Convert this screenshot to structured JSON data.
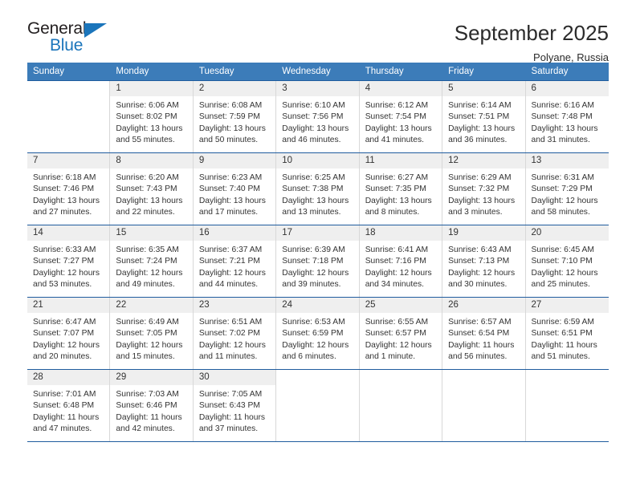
{
  "brand": {
    "name_top": "General",
    "name_bottom": "Blue",
    "triangle_icon": "triangle-icon",
    "accent_color": "#1b75bb"
  },
  "header": {
    "title": "September 2025",
    "subtitle": "Polyane, Russia"
  },
  "theme": {
    "header_bg": "#3c7cb9",
    "row_divider": "#1f5c9e",
    "daynum_bg": "#efefef",
    "text": "#333333"
  },
  "weekday_headers": [
    "Sunday",
    "Monday",
    "Tuesday",
    "Wednesday",
    "Thursday",
    "Friday",
    "Saturday"
  ],
  "weeks": [
    [
      {
        "day": "",
        "sunrise": "",
        "sunset": "",
        "daylight_1": "",
        "daylight_2": ""
      },
      {
        "day": "1",
        "sunrise": "Sunrise: 6:06 AM",
        "sunset": "Sunset: 8:02 PM",
        "daylight_1": "Daylight: 13 hours",
        "daylight_2": "and 55 minutes."
      },
      {
        "day": "2",
        "sunrise": "Sunrise: 6:08 AM",
        "sunset": "Sunset: 7:59 PM",
        "daylight_1": "Daylight: 13 hours",
        "daylight_2": "and 50 minutes."
      },
      {
        "day": "3",
        "sunrise": "Sunrise: 6:10 AM",
        "sunset": "Sunset: 7:56 PM",
        "daylight_1": "Daylight: 13 hours",
        "daylight_2": "and 46 minutes."
      },
      {
        "day": "4",
        "sunrise": "Sunrise: 6:12 AM",
        "sunset": "Sunset: 7:54 PM",
        "daylight_1": "Daylight: 13 hours",
        "daylight_2": "and 41 minutes."
      },
      {
        "day": "5",
        "sunrise": "Sunrise: 6:14 AM",
        "sunset": "Sunset: 7:51 PM",
        "daylight_1": "Daylight: 13 hours",
        "daylight_2": "and 36 minutes."
      },
      {
        "day": "6",
        "sunrise": "Sunrise: 6:16 AM",
        "sunset": "Sunset: 7:48 PM",
        "daylight_1": "Daylight: 13 hours",
        "daylight_2": "and 31 minutes."
      }
    ],
    [
      {
        "day": "7",
        "sunrise": "Sunrise: 6:18 AM",
        "sunset": "Sunset: 7:46 PM",
        "daylight_1": "Daylight: 13 hours",
        "daylight_2": "and 27 minutes."
      },
      {
        "day": "8",
        "sunrise": "Sunrise: 6:20 AM",
        "sunset": "Sunset: 7:43 PM",
        "daylight_1": "Daylight: 13 hours",
        "daylight_2": "and 22 minutes."
      },
      {
        "day": "9",
        "sunrise": "Sunrise: 6:23 AM",
        "sunset": "Sunset: 7:40 PM",
        "daylight_1": "Daylight: 13 hours",
        "daylight_2": "and 17 minutes."
      },
      {
        "day": "10",
        "sunrise": "Sunrise: 6:25 AM",
        "sunset": "Sunset: 7:38 PM",
        "daylight_1": "Daylight: 13 hours",
        "daylight_2": "and 13 minutes."
      },
      {
        "day": "11",
        "sunrise": "Sunrise: 6:27 AM",
        "sunset": "Sunset: 7:35 PM",
        "daylight_1": "Daylight: 13 hours",
        "daylight_2": "and 8 minutes."
      },
      {
        "day": "12",
        "sunrise": "Sunrise: 6:29 AM",
        "sunset": "Sunset: 7:32 PM",
        "daylight_1": "Daylight: 13 hours",
        "daylight_2": "and 3 minutes."
      },
      {
        "day": "13",
        "sunrise": "Sunrise: 6:31 AM",
        "sunset": "Sunset: 7:29 PM",
        "daylight_1": "Daylight: 12 hours",
        "daylight_2": "and 58 minutes."
      }
    ],
    [
      {
        "day": "14",
        "sunrise": "Sunrise: 6:33 AM",
        "sunset": "Sunset: 7:27 PM",
        "daylight_1": "Daylight: 12 hours",
        "daylight_2": "and 53 minutes."
      },
      {
        "day": "15",
        "sunrise": "Sunrise: 6:35 AM",
        "sunset": "Sunset: 7:24 PM",
        "daylight_1": "Daylight: 12 hours",
        "daylight_2": "and 49 minutes."
      },
      {
        "day": "16",
        "sunrise": "Sunrise: 6:37 AM",
        "sunset": "Sunset: 7:21 PM",
        "daylight_1": "Daylight: 12 hours",
        "daylight_2": "and 44 minutes."
      },
      {
        "day": "17",
        "sunrise": "Sunrise: 6:39 AM",
        "sunset": "Sunset: 7:18 PM",
        "daylight_1": "Daylight: 12 hours",
        "daylight_2": "and 39 minutes."
      },
      {
        "day": "18",
        "sunrise": "Sunrise: 6:41 AM",
        "sunset": "Sunset: 7:16 PM",
        "daylight_1": "Daylight: 12 hours",
        "daylight_2": "and 34 minutes."
      },
      {
        "day": "19",
        "sunrise": "Sunrise: 6:43 AM",
        "sunset": "Sunset: 7:13 PM",
        "daylight_1": "Daylight: 12 hours",
        "daylight_2": "and 30 minutes."
      },
      {
        "day": "20",
        "sunrise": "Sunrise: 6:45 AM",
        "sunset": "Sunset: 7:10 PM",
        "daylight_1": "Daylight: 12 hours",
        "daylight_2": "and 25 minutes."
      }
    ],
    [
      {
        "day": "21",
        "sunrise": "Sunrise: 6:47 AM",
        "sunset": "Sunset: 7:07 PM",
        "daylight_1": "Daylight: 12 hours",
        "daylight_2": "and 20 minutes."
      },
      {
        "day": "22",
        "sunrise": "Sunrise: 6:49 AM",
        "sunset": "Sunset: 7:05 PM",
        "daylight_1": "Daylight: 12 hours",
        "daylight_2": "and 15 minutes."
      },
      {
        "day": "23",
        "sunrise": "Sunrise: 6:51 AM",
        "sunset": "Sunset: 7:02 PM",
        "daylight_1": "Daylight: 12 hours",
        "daylight_2": "and 11 minutes."
      },
      {
        "day": "24",
        "sunrise": "Sunrise: 6:53 AM",
        "sunset": "Sunset: 6:59 PM",
        "daylight_1": "Daylight: 12 hours",
        "daylight_2": "and 6 minutes."
      },
      {
        "day": "25",
        "sunrise": "Sunrise: 6:55 AM",
        "sunset": "Sunset: 6:57 PM",
        "daylight_1": "Daylight: 12 hours",
        "daylight_2": "and 1 minute."
      },
      {
        "day": "26",
        "sunrise": "Sunrise: 6:57 AM",
        "sunset": "Sunset: 6:54 PM",
        "daylight_1": "Daylight: 11 hours",
        "daylight_2": "and 56 minutes."
      },
      {
        "day": "27",
        "sunrise": "Sunrise: 6:59 AM",
        "sunset": "Sunset: 6:51 PM",
        "daylight_1": "Daylight: 11 hours",
        "daylight_2": "and 51 minutes."
      }
    ],
    [
      {
        "day": "28",
        "sunrise": "Sunrise: 7:01 AM",
        "sunset": "Sunset: 6:48 PM",
        "daylight_1": "Daylight: 11 hours",
        "daylight_2": "and 47 minutes."
      },
      {
        "day": "29",
        "sunrise": "Sunrise: 7:03 AM",
        "sunset": "Sunset: 6:46 PM",
        "daylight_1": "Daylight: 11 hours",
        "daylight_2": "and 42 minutes."
      },
      {
        "day": "30",
        "sunrise": "Sunrise: 7:05 AM",
        "sunset": "Sunset: 6:43 PM",
        "daylight_1": "Daylight: 11 hours",
        "daylight_2": "and 37 minutes."
      },
      {
        "day": "",
        "sunrise": "",
        "sunset": "",
        "daylight_1": "",
        "daylight_2": ""
      },
      {
        "day": "",
        "sunrise": "",
        "sunset": "",
        "daylight_1": "",
        "daylight_2": ""
      },
      {
        "day": "",
        "sunrise": "",
        "sunset": "",
        "daylight_1": "",
        "daylight_2": ""
      },
      {
        "day": "",
        "sunrise": "",
        "sunset": "",
        "daylight_1": "",
        "daylight_2": ""
      }
    ]
  ]
}
